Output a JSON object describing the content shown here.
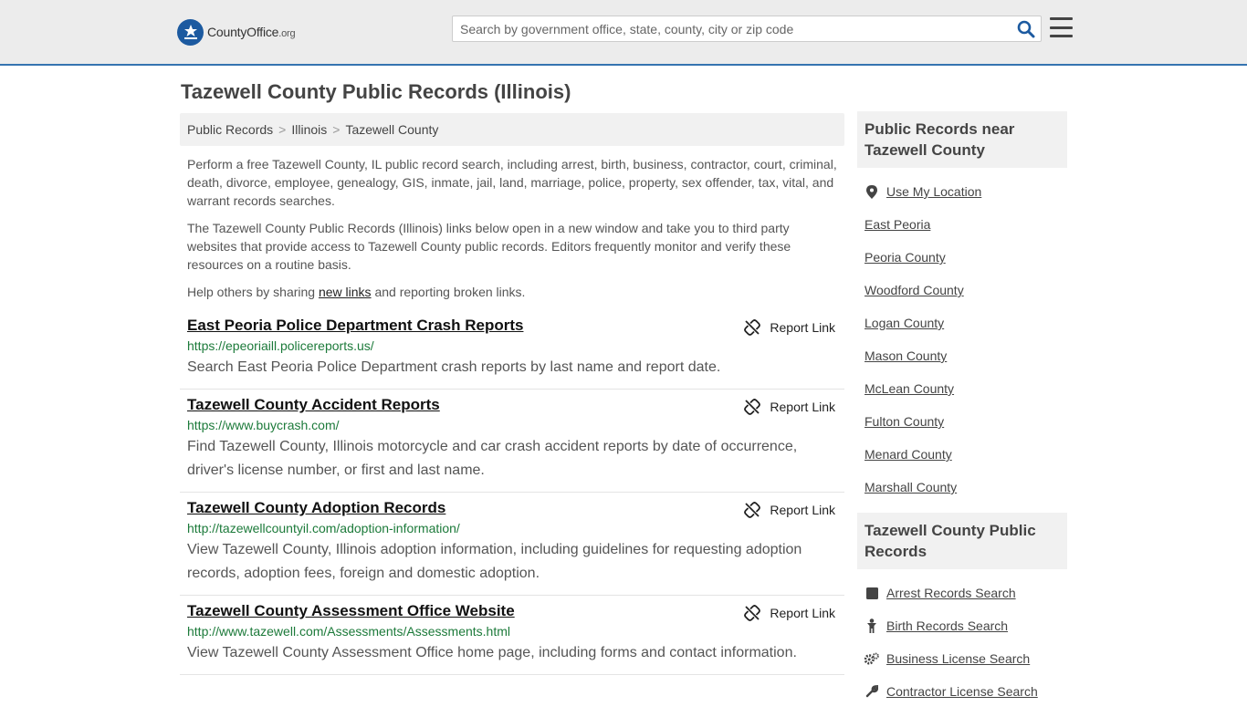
{
  "header": {
    "logo_main": "CountyOffice",
    "logo_suffix": ".org",
    "search_placeholder": "Search by government office, state, county, city or zip code"
  },
  "page_title": "Tazewell County Public Records (Illinois)",
  "breadcrumb": [
    {
      "label": "Public Records"
    },
    {
      "label": "Illinois"
    },
    {
      "label": "Tazewell County"
    }
  ],
  "intro": {
    "p1": "Perform a free Tazewell County, IL public record search, including arrest, birth, business, contractor, court, criminal, death, divorce, employee, genealogy, GIS, inmate, jail, land, marriage, police, property, sex offender, tax, vital, and warrant records searches.",
    "p2": "The Tazewell County Public Records (Illinois) links below open in a new window and take you to third party websites that provide access to Tazewell County public records. Editors frequently monitor and verify these resources on a routine basis.",
    "p3_before": "Help others by sharing ",
    "p3_link": "new links",
    "p3_after": " and reporting broken links."
  },
  "report_label": "Report Link",
  "records": [
    {
      "title": "East Peoria Police Department Crash Reports",
      "url": "https://epeoriaill.policereports.us/",
      "desc": "Search East Peoria Police Department crash reports by last name and report date."
    },
    {
      "title": "Tazewell County Accident Reports",
      "url": "https://www.buycrash.com/",
      "desc": "Find Tazewell County, Illinois motorcycle and car crash accident reports by date of occurrence, driver's license number, or first and last name."
    },
    {
      "title": "Tazewell County Adoption Records",
      "url": "http://tazewellcountyil.com/adoption-information/",
      "desc": "View Tazewell County, Illinois adoption information, including guidelines for requesting adoption records, adoption fees, foreign and domestic adoption."
    },
    {
      "title": "Tazewell County Assessment Office Website",
      "url": "http://www.tazewell.com/Assessments/Assessments.html",
      "desc": "View Tazewell County Assessment Office home page, including forms and contact information."
    }
  ],
  "sidebar": {
    "near_title": "Public Records near Tazewell County",
    "near_items": [
      {
        "label": "Use My Location",
        "icon": "map-pin-icon"
      },
      {
        "label": "East Peoria"
      },
      {
        "label": "Peoria County"
      },
      {
        "label": "Woodford County"
      },
      {
        "label": "Logan County"
      },
      {
        "label": "Mason County"
      },
      {
        "label": "McLean County"
      },
      {
        "label": "Fulton County"
      },
      {
        "label": "Menard County"
      },
      {
        "label": "Marshall County"
      }
    ],
    "records_title": "Tazewell County Public Records",
    "records_items": [
      {
        "label": "Arrest Records Search",
        "icon": "square-icon"
      },
      {
        "label": "Birth Records Search",
        "icon": "child-icon"
      },
      {
        "label": "Business License Search",
        "icon": "gears-icon"
      },
      {
        "label": "Contractor License Search",
        "icon": "wrench-icon"
      }
    ]
  }
}
